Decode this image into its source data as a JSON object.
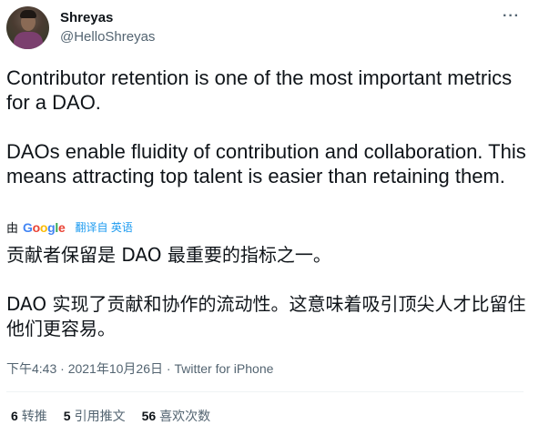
{
  "author": {
    "name": "Shreyas",
    "handle": "@HelloShreyas"
  },
  "more_menu": "···",
  "tweet": {
    "paragraphs": [
      "Contributor retention is one of the most important metrics for a DAO.",
      "DAOs enable fluidity of contribution and collaboration. This means attracting top talent is easier than retaining them."
    ]
  },
  "translation": {
    "prefix_glyph": "由",
    "provider_letters": [
      "G",
      "o",
      "o",
      "g",
      "l",
      "e"
    ],
    "link_text": "翻译自 英语",
    "paragraphs": [
      "贡献者保留是 DAO 最重要的指标之一。",
      "DAO 实现了贡献和协作的流动性。这意味着吸引顶尖人才比留住他们更容易。"
    ]
  },
  "meta": {
    "time": "下午4:43",
    "date": "2021年10月26日",
    "source": "Twitter for iPhone",
    "separator": "·"
  },
  "stats": {
    "retweets_count": "6",
    "retweets_label": "转推",
    "quotes_count": "5",
    "quotes_label": "引用推文",
    "likes_count": "56",
    "likes_label": "喜欢次数"
  },
  "colors": {
    "text": "#0f1419",
    "secondary": "#536471",
    "link": "#1d9bf0",
    "divider": "#eff3f4"
  }
}
